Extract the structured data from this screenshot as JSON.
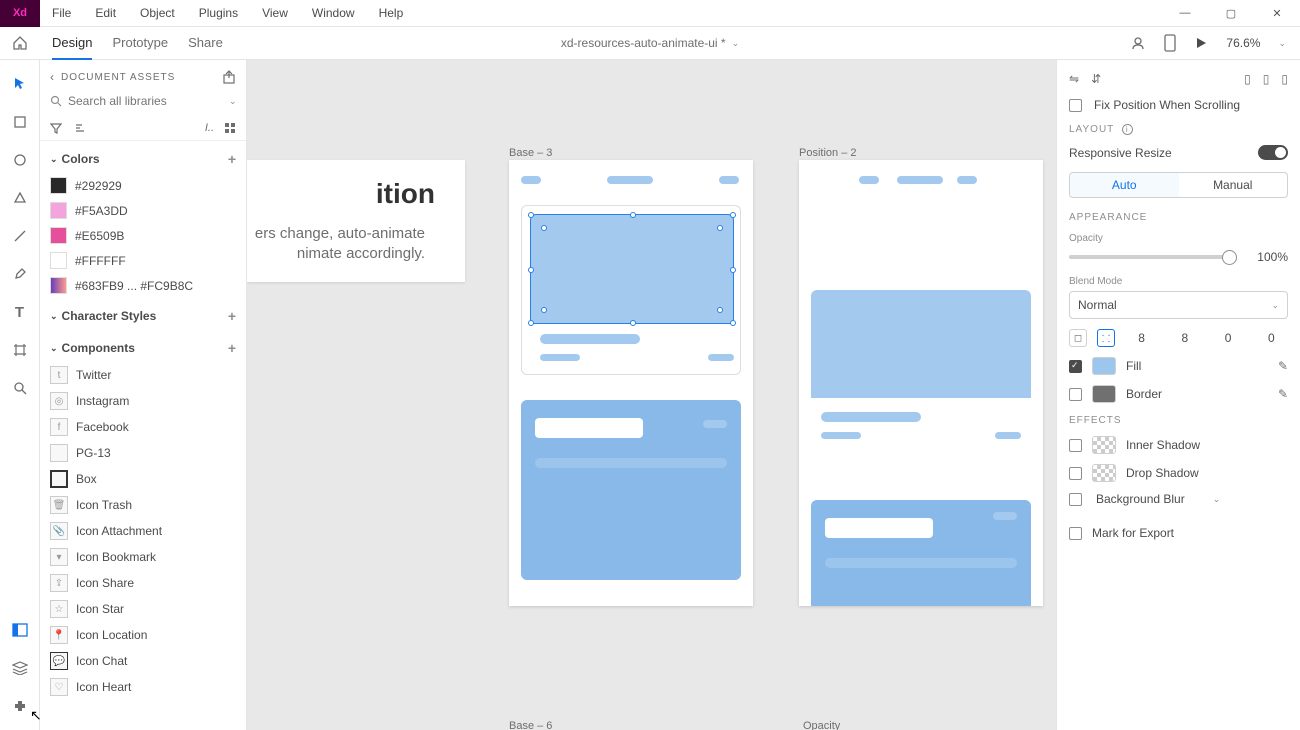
{
  "menu": {
    "file": "File",
    "edit": "Edit",
    "object": "Object",
    "plugins": "Plugins",
    "view": "View",
    "window": "Window",
    "help": "Help"
  },
  "tabs": {
    "design": "Design",
    "prototype": "Prototype",
    "share": "Share"
  },
  "document_title": "xd-resources-auto-animate-ui *",
  "zoom": "76.6%",
  "assets": {
    "title": "DOCUMENT ASSETS",
    "search_placeholder": "Search all libraries",
    "sections": {
      "colors": "Colors",
      "charstyles": "Character Styles",
      "components": "Components"
    },
    "colors": [
      {
        "hex": "#292929",
        "label": "#292929"
      },
      {
        "hex": "#F5A3DD",
        "label": "#F5A3DD"
      },
      {
        "hex": "#E6509B",
        "label": "#E6509B"
      },
      {
        "hex": "#FFFFFF",
        "label": "#FFFFFF"
      },
      {
        "hex": "linear",
        "label": "#683FB9 ... #FC9B8C"
      }
    ],
    "components": [
      "Twitter",
      "Instagram",
      "Facebook",
      "PG-13",
      "Box",
      "Icon Trash",
      "Icon Attachment",
      "Icon Bookmark",
      "Icon Share",
      "Icon Star",
      "Icon Location",
      "Icon Chat",
      "Icon Heart"
    ]
  },
  "artboards": {
    "a1": "Base – 3",
    "a2": "Position – 2",
    "a3": "Base – 6",
    "a4_prop": "Opacity"
  },
  "canvas_text": {
    "title_frag": "ition",
    "line1": "ers change, auto-animate",
    "line2": "nimate accordingly."
  },
  "inspector": {
    "fix": "Fix Position When Scrolling",
    "layout": "LAYOUT",
    "responsive": "Responsive Resize",
    "auto": "Auto",
    "manual": "Manual",
    "appearance": "APPEARANCE",
    "opacity_label": "Opacity",
    "opacity_value": "100%",
    "blend_label": "Blend Mode",
    "blend_value": "Normal",
    "corners": [
      "8",
      "8",
      "0",
      "0"
    ],
    "fill": "Fill",
    "fill_color": "#9dc6ed",
    "border": "Border",
    "border_color": "#707070",
    "effects": "EFFECTS",
    "inner": "Inner Shadow",
    "drop": "Drop Shadow",
    "blur": "Background Blur",
    "export": "Mark for Export"
  }
}
